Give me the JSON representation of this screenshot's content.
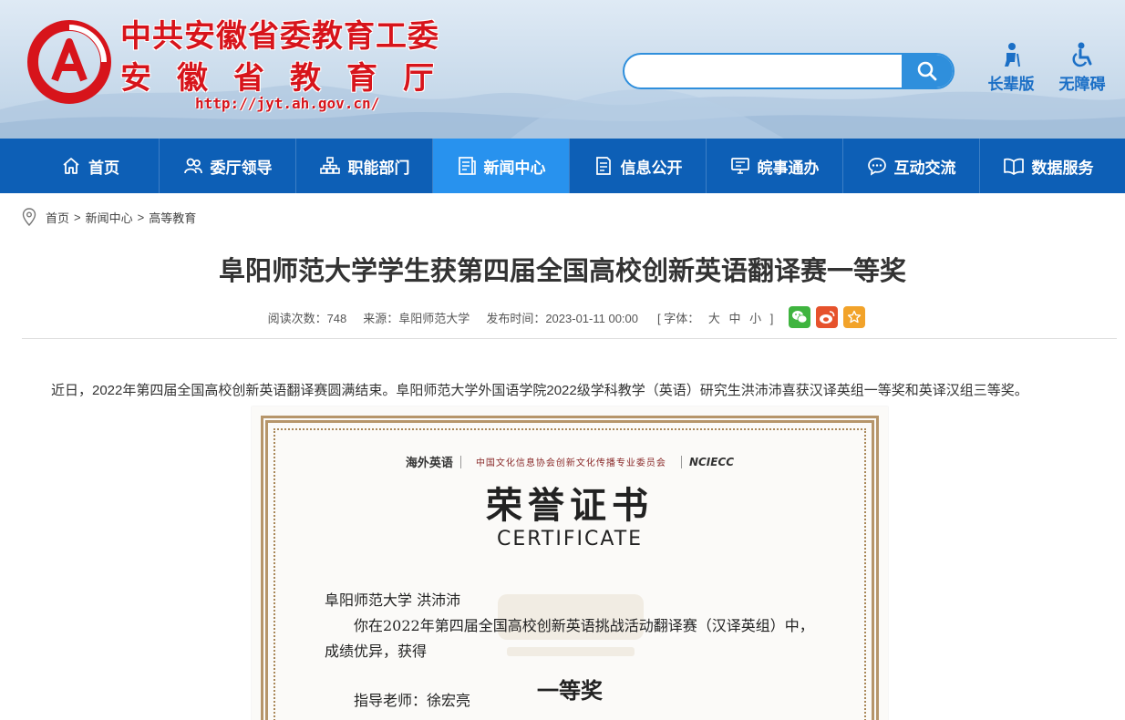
{
  "header": {
    "title_line1": "中共安徽省委教育工委",
    "title_line2": "安徽省教育厅",
    "url": "http://jyt.ah.gov.cn/",
    "search_placeholder": "",
    "tools": [
      {
        "label": "长辈版",
        "icon": "elder-icon"
      },
      {
        "label": "无障碍",
        "icon": "wheelchair-icon"
      }
    ]
  },
  "nav": {
    "items": [
      {
        "label": "首页",
        "icon": "home-icon"
      },
      {
        "label": "委厅领导",
        "icon": "people-icon"
      },
      {
        "label": "职能部门",
        "icon": "org-chart-icon"
      },
      {
        "label": "新闻中心",
        "icon": "news-icon",
        "active": true
      },
      {
        "label": "信息公开",
        "icon": "document-icon"
      },
      {
        "label": "皖事通办",
        "icon": "monitor-icon"
      },
      {
        "label": "互动交流",
        "icon": "chat-icon"
      },
      {
        "label": "数据服务",
        "icon": "book-icon"
      }
    ]
  },
  "breadcrumb": [
    "首页",
    "新闻中心",
    "高等教育"
  ],
  "article": {
    "title": "阜阳师范大学学生获第四届全国高校创新英语翻译赛一等奖",
    "meta": {
      "views_label": "阅读次数：",
      "views": "748",
      "source_label": "来源：",
      "source": "阜阳师范大学",
      "date_label": "发布时间：",
      "date": "2023-01-11 00:00",
      "font_label": "[ 字体：",
      "font_sizes": [
        "大",
        "中",
        "小"
      ],
      "font_close": "]"
    },
    "intro": "近日，2022年第四届全国高校创新英语翻译赛圆满结束。阜阳师范大学外国语学院2022级学科教学（英语）研究生洪沛沛喜获汉译英组一等奖和英译汉组三等奖。"
  },
  "certificate": {
    "logo1": "海外英语",
    "logo2": "中国文化信息协会创新文化传播专业委员会",
    "logo3": "NCIECC",
    "title": "荣誉证书",
    "subtitle": "CERTIFICATE",
    "recipient": "阜阳师范大学 洪沛沛",
    "line1": "你在2022年第四届全国高校创新英语挑战活动翻译赛（汉译英组）中，",
    "line2": "成绩优异，获得",
    "award": "一等奖",
    "teacher": "指导老师：徐宏亮"
  },
  "colors": {
    "brand_red": "#d7141b",
    "nav_blue": "#0d5fb6",
    "nav_active": "#2892ee",
    "search_blue": "#2f8fdc"
  }
}
